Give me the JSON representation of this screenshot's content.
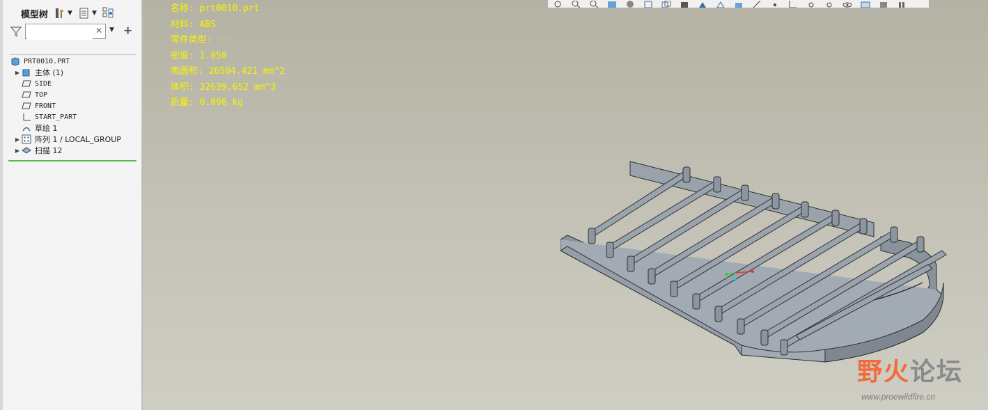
{
  "sidebar": {
    "title": "模型树",
    "search": {
      "value": "",
      "placeholder": ""
    },
    "tree": [
      {
        "label": "PRT0010.PRT",
        "icon": "part-icon",
        "expandable": false,
        "indent": 0
      },
      {
        "label": "主体 (1)",
        "icon": "body-icon",
        "expandable": true,
        "indent": 1
      },
      {
        "label": "SIDE",
        "icon": "datum-plane-icon",
        "expandable": false,
        "indent": 1
      },
      {
        "label": "TOP",
        "icon": "datum-plane-icon",
        "expandable": false,
        "indent": 1
      },
      {
        "label": "FRONT",
        "icon": "datum-plane-icon",
        "expandable": false,
        "indent": 1
      },
      {
        "label": "START_PART",
        "icon": "coordinate-system-icon",
        "expandable": false,
        "indent": 1
      },
      {
        "label": "草绘 1",
        "icon": "sketch-icon",
        "expandable": false,
        "indent": 1
      },
      {
        "label": "阵列 1 / LOCAL_GROUP",
        "icon": "pattern-icon",
        "expandable": true,
        "indent": 1
      },
      {
        "label": "扫描 12",
        "icon": "sweep-icon",
        "expandable": true,
        "indent": 1
      }
    ]
  },
  "info": [
    "名称: prt0010.prt",
    "材料: ABS",
    "零件类型: --",
    "密度: 1.050",
    "表面积: 26504.421 mm^2",
    "体积: 32639.652 mm^3",
    "质量: 0.096 kg"
  ],
  "watermark": {
    "text_a": "野火",
    "text_b": "论坛",
    "url": "www.proewildfire.cn"
  },
  "colors": {
    "info_text": "#f5f500",
    "viewport_bg": "#c0beb1",
    "model": "#8a939c",
    "tree_accent": "#5ab84a",
    "wm_orange": "#f26b3a",
    "wm_grey": "#8a8a8a"
  }
}
